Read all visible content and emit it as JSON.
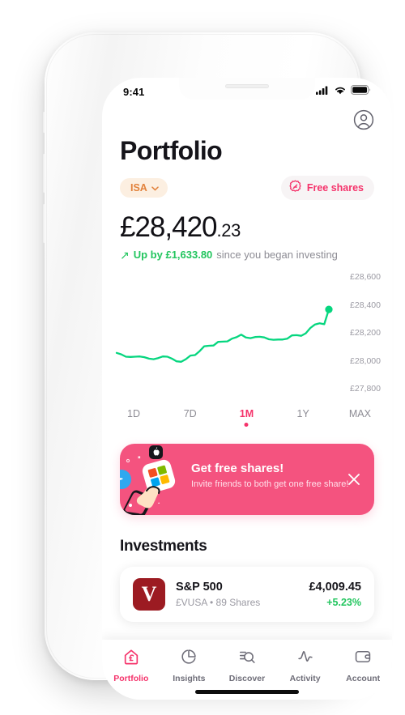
{
  "status_bar": {
    "time": "9:41",
    "signal_icon": "cellular-signal-icon",
    "wifi_icon": "wifi-icon",
    "battery_icon": "battery-icon"
  },
  "header": {
    "title": "Portfolio",
    "avatar_icon": "account-avatar-icon"
  },
  "pills": {
    "account_type": "ISA",
    "account_type_chevron": "chevron-down-icon",
    "free_shares": "Free shares",
    "free_shares_icon": "free-shares-badge-icon",
    "account_type_color": "#e2813b",
    "account_type_bg": "#fcefe1",
    "free_shares_color": "#f5336b",
    "free_shares_bg": "#f7f4f5"
  },
  "balance": {
    "main": "£28,420",
    "cents": ".23",
    "arrow": "↗",
    "change_value": "Up by £1,633.80",
    "change_suffix": "since you began investing",
    "positive_color": "#22c55e"
  },
  "chart_data": {
    "type": "line",
    "title": "",
    "xlabel": "",
    "ylabel": "",
    "line_color": "#06d67f",
    "grid": false,
    "legend": "none",
    "ylim": [
      27750,
      28700
    ],
    "ytick_labels": [
      "£28,600",
      "£28,400",
      "£28,200",
      "£28,000",
      "£27,800"
    ],
    "ytick_values": [
      28600,
      28400,
      28200,
      28000,
      27800
    ],
    "end_marker_value": 28420,
    "values": [
      28045,
      28032,
      28012,
      28010,
      28012,
      28014,
      28008,
      27995,
      27990,
      28000,
      28014,
      28012,
      27995,
      27972,
      27968,
      27990,
      28022,
      28026,
      28060,
      28102,
      28106,
      28108,
      28140,
      28142,
      28144,
      28168,
      28180,
      28202,
      28178,
      28172,
      28182,
      28184,
      28178,
      28162,
      28158,
      28160,
      28160,
      28168,
      28196,
      28198,
      28192,
      28214,
      28260,
      28290,
      28300,
      28292,
      28420
    ]
  },
  "range_selector": {
    "options": [
      "1D",
      "7D",
      "1M",
      "1Y",
      "MAX"
    ],
    "selected": "1M",
    "selected_color": "#f5336b"
  },
  "promo": {
    "title": "Get free shares!",
    "subtitle": "Invite friends to both get one free share!",
    "close_icon": "close-icon",
    "illustration_icon": "hand-tapping-app-tile-icon",
    "apple_icon": "apple-logo-icon",
    "twitter_icon": "twitter-bird-icon",
    "microsoft_icon": "microsoft-logo-icon",
    "background_color": "#f4537f"
  },
  "investments": {
    "section_title": "Investments",
    "items": [
      {
        "logo_letter": "V",
        "logo_color": "#9c1b22",
        "name": "S&P 500",
        "subtitle": "£VUSA • 89 Shares",
        "value": "£4,009.45",
        "change": "+5.23%",
        "change_color": "#22c55e"
      }
    ]
  },
  "bottom_nav": {
    "items": [
      {
        "label": "Portfolio",
        "icon": "home-pound-icon",
        "active": true
      },
      {
        "label": "Insights",
        "icon": "pie-chart-icon",
        "active": false
      },
      {
        "label": "Discover",
        "icon": "search-list-icon",
        "active": false
      },
      {
        "label": "Activity",
        "icon": "pulse-wave-icon",
        "active": false
      },
      {
        "label": "Account",
        "icon": "wallet-card-icon",
        "active": false
      }
    ],
    "active_color": "#f5336b",
    "inactive_color": "#6e6d78"
  }
}
